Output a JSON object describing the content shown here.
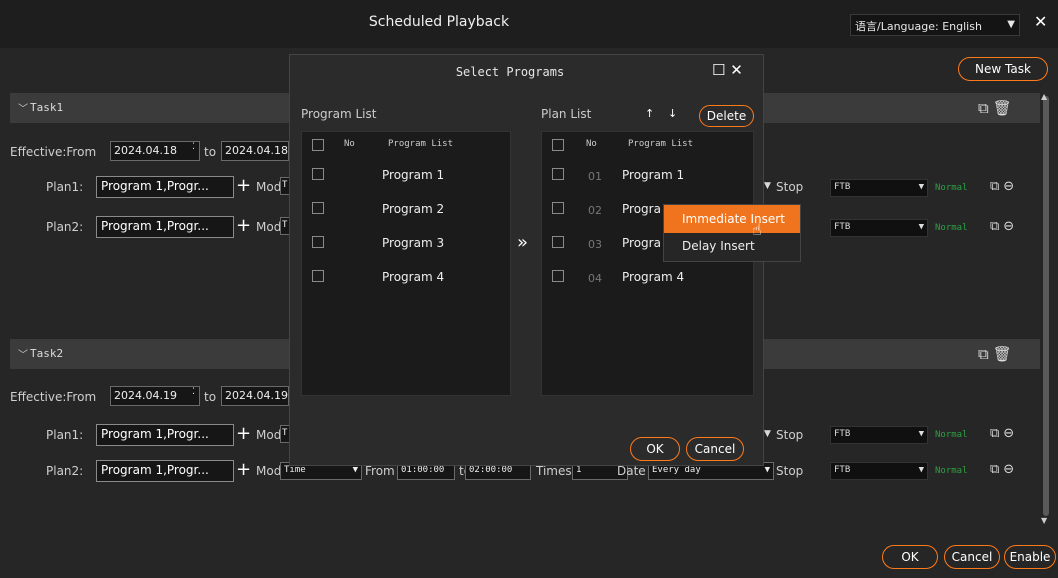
{
  "window": {
    "title": "Scheduled Playback",
    "language_value": "语言/Language: English",
    "new_task_label": "New Task"
  },
  "tasks": [
    {
      "name": "Task1",
      "effective_label": "Effective:From",
      "from_date": "2024.04.18",
      "to_label": "to",
      "to_date": "2024.04.18",
      "plans": [
        {
          "label": "Plan1:",
          "program": "Program 1,Progr...",
          "mode_label": "Mode",
          "mode_value": "T",
          "stop_label": "Stop",
          "ftb": "FTB",
          "status": "Normal"
        },
        {
          "label": "Plan2:",
          "program": "Program 1,Progr...",
          "mode_label": "Mode",
          "mode_value": "T",
          "stop_label": "",
          "ftb": "FTB",
          "status": "Normal"
        }
      ]
    },
    {
      "name": "Task2",
      "effective_label": "Effective:From",
      "from_date": "2024.04.19",
      "to_label": "to",
      "to_date": "2024.04.19",
      "plans": [
        {
          "label": "Plan1:",
          "program": "Program 1,Progr...",
          "mode_label": "Mode",
          "mode_value": "T",
          "stop_label": "Stop",
          "ftb": "FTB",
          "status": "Normal"
        },
        {
          "label": "Plan2:",
          "program": "Program 1,Progr...",
          "mode_label": "Mode",
          "mode_value": "Time",
          "from_label": "From",
          "from_time": "01:00:00",
          "to_label": "to",
          "to_time": "02:00:00",
          "times_label": "Times",
          "times_value": "1",
          "date_label": "Date",
          "date_value": "Every day",
          "stop_label": "Stop",
          "ftb": "FTB",
          "status": "Normal"
        }
      ]
    }
  ],
  "footer": {
    "ok": "OK",
    "cancel": "Cancel",
    "enable": "Enable"
  },
  "modal": {
    "title": "Select Programs",
    "program_list_title": "Program List",
    "plan_list_title": "Plan List",
    "col_no": "No",
    "col_program": "Program  List",
    "transfer_icon": "»",
    "delete_label": "Delete",
    "ok": "OK",
    "cancel": "Cancel",
    "programs": [
      "Program 1",
      "Program 2",
      "Program 3",
      "Program 4"
    ],
    "plan_items": [
      {
        "no": "01",
        "name": "Program 1"
      },
      {
        "no": "02",
        "name": "Progra"
      },
      {
        "no": "03",
        "name": "Progra"
      },
      {
        "no": "04",
        "name": "Program 4"
      }
    ]
  },
  "context_menu": {
    "items": [
      "Immediate Insert",
      "Delay Insert"
    ]
  },
  "colors": {
    "accent": "#f0741e",
    "status_green": "#2ea043",
    "background": "#262626"
  }
}
